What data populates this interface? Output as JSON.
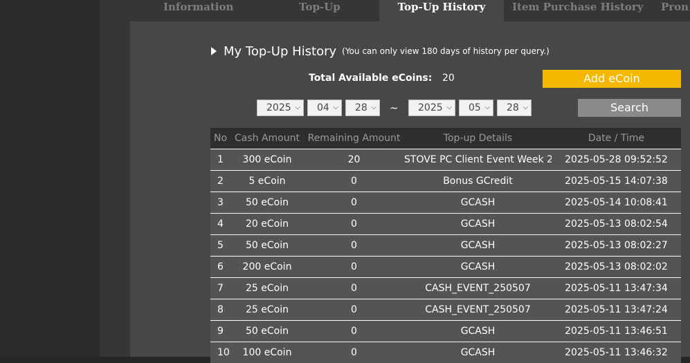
{
  "tabs": [
    {
      "label": "Information"
    },
    {
      "label": "Top-Up"
    },
    {
      "label": "Top-Up History"
    },
    {
      "label": "Item Purchase History"
    },
    {
      "label": "Pron"
    }
  ],
  "section": {
    "title": "My Top-Up History",
    "note": "(You can only view 180 days of history per query.)"
  },
  "coins": {
    "label": "Total Available eCoins:",
    "value": "20",
    "add_label": "Add eCoin"
  },
  "filter": {
    "start_year": "2025",
    "start_month": "04",
    "start_day": "28",
    "separator": "~",
    "end_year": "2025",
    "end_month": "05",
    "end_day": "28",
    "search_label": "Search"
  },
  "table": {
    "headers": [
      "No",
      "Cash Amount",
      "Remaining Amount",
      "Top-up Details",
      "Date / Time"
    ],
    "rows": [
      [
        "1",
        "300 eCoin",
        "20",
        "STOVE PC Client Event Week 2",
        "2025-05-28 09:52:52"
      ],
      [
        "2",
        "5 eCoin",
        "0",
        "Bonus GCredit",
        "2025-05-15 14:07:38"
      ],
      [
        "3",
        "50 eCoin",
        "0",
        "GCASH",
        "2025-05-14 10:08:41"
      ],
      [
        "4",
        "20 eCoin",
        "0",
        "GCASH",
        "2025-05-13 08:02:54"
      ],
      [
        "5",
        "50 eCoin",
        "0",
        "GCASH",
        "2025-05-13 08:02:27"
      ],
      [
        "6",
        "200 eCoin",
        "0",
        "GCASH",
        "2025-05-13 08:02:02"
      ],
      [
        "7",
        "25 eCoin",
        "0",
        "CASH_EVENT_250507",
        "2025-05-11 13:47:34"
      ],
      [
        "8",
        "25 eCoin",
        "0",
        "CASH_EVENT_250507",
        "2025-05-11 13:47:24"
      ],
      [
        "9",
        "50 eCoin",
        "0",
        "GCASH",
        "2025-05-11 13:46:51"
      ],
      [
        "10",
        "100 eCoin",
        "0",
        "GCASH",
        "2025-05-11 13:46:32"
      ]
    ]
  }
}
